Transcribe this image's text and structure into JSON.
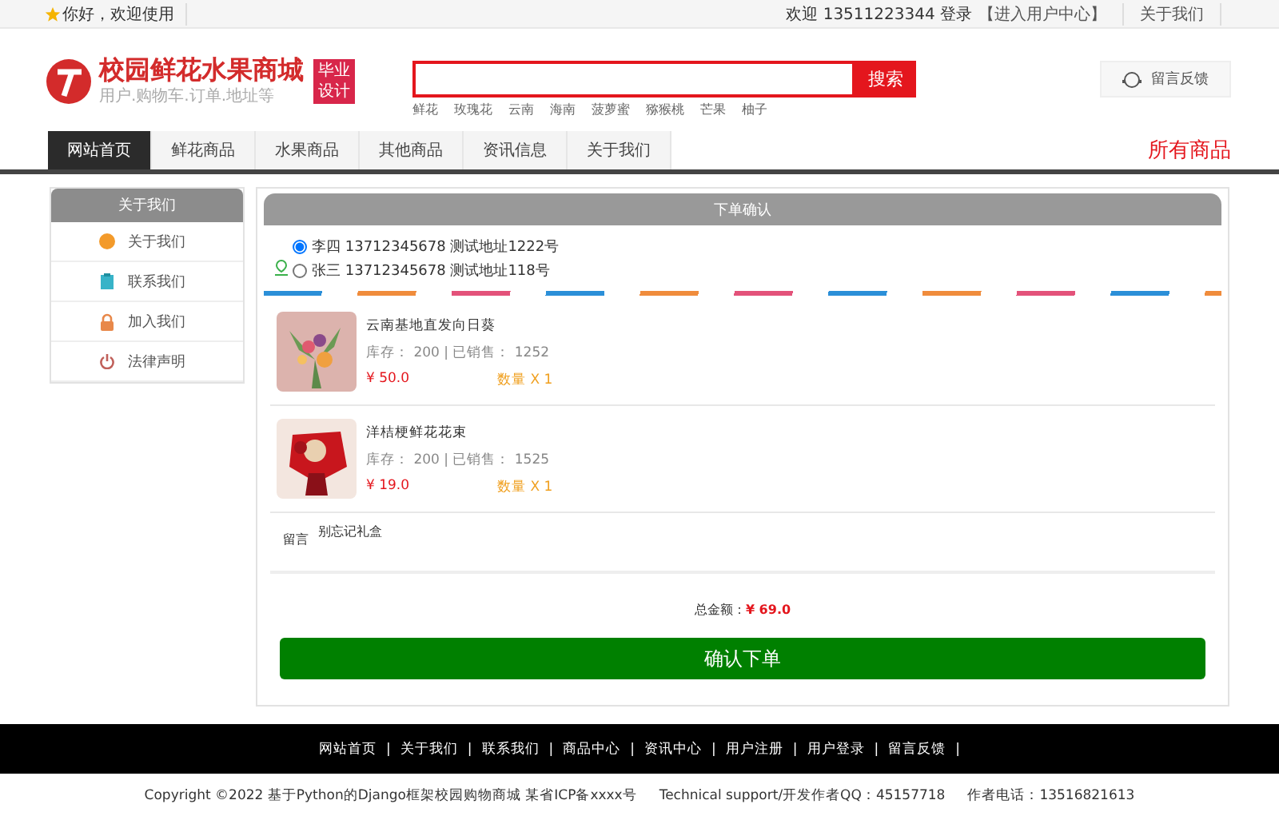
{
  "top_bar": {
    "greeting": "你好，欢迎使用",
    "welcome": "欢迎 13511223344 登录",
    "user_center": "【进入用户中心】",
    "about": "关于我们"
  },
  "header": {
    "logo_title": "校园鲜花水果商城",
    "logo_subtitle": "用户.购物车.订单.地址等",
    "badge": [
      "毕业",
      "设计"
    ],
    "search": {
      "button": "搜索"
    },
    "hot_words": [
      "鲜花",
      "玫瑰花",
      "云南",
      "海南",
      "菠萝蜜",
      "猕猴桃",
      "芒果",
      "柚子"
    ],
    "feedback": "留言反馈"
  },
  "nav": {
    "tabs": [
      {
        "label": "网站首页",
        "selected": true
      },
      {
        "label": "鲜花商品",
        "selected": false
      },
      {
        "label": "水果商品",
        "selected": false
      },
      {
        "label": "其他商品",
        "selected": false
      },
      {
        "label": "资讯信息",
        "selected": false
      },
      {
        "label": "关于我们",
        "selected": false
      }
    ],
    "all_goods": "所有商品"
  },
  "sidebar": {
    "title": "关于我们",
    "items": [
      {
        "label": "关于我们",
        "kind": "dot"
      },
      {
        "label": "联系我们",
        "kind": "clipboard"
      },
      {
        "label": "加入我们",
        "kind": "lock"
      },
      {
        "label": "法律声明",
        "kind": "power"
      }
    ]
  },
  "order": {
    "title": "下单确认",
    "addresses": [
      {
        "label": "李四 13712345678 测试地址1222号",
        "selected": true
      },
      {
        "label": "张三 13712345678 测试地址118号",
        "selected": false
      }
    ],
    "products": [
      {
        "name": "云南基地直发向日葵",
        "stock": "库存： 200 | 已销售： 1252",
        "price": "¥ 50.0",
        "quantity": "数量 X 1",
        "kind": "picture"
      },
      {
        "name": "洋桔梗鲜花花束",
        "stock": "库存： 200 | 已销售： 1525",
        "price": "¥ 19.0",
        "quantity": "数量 X 1",
        "kind": "picture"
      }
    ],
    "note_label": "留言",
    "note_value": "别忘记礼盒",
    "total_label": "总金额：",
    "total_value": "¥ 69.0",
    "confirm": "确认下单"
  },
  "footer": {
    "links": [
      "网站首页",
      "关于我们",
      "联系我们",
      "商品中心",
      "资讯中心",
      "用户注册",
      "用户登录",
      "留言反馈"
    ],
    "separator": "|",
    "copyright": "Copyright ©2022 基于Python的Django框架校园购物商城 某省ICP备xxxx号",
    "support": "Technical support/开发作者QQ：45157718",
    "phone": "作者电话：13516821613"
  }
}
